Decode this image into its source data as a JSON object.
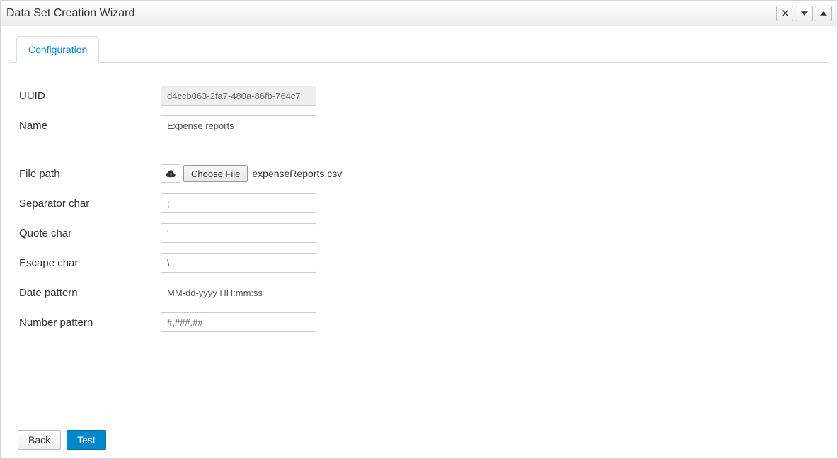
{
  "window": {
    "title": "Data Set Creation Wizard"
  },
  "tabs": {
    "active": "Configuration"
  },
  "form": {
    "uuid_label": "UUID",
    "uuid_value": "d4ccb063-2fa7-480a-86fb-764c7",
    "name_label": "Name",
    "name_value": "Expense reports",
    "file_path_label": "File path",
    "choose_file_label": "Choose File",
    "file_name": "expenseReports.csv",
    "separator_label": "Separator char",
    "separator_value": ";",
    "quote_label": "Quote char",
    "quote_value": "'",
    "escape_label": "Escape char",
    "escape_value": "\\",
    "date_pattern_label": "Date pattern",
    "date_pattern_value": "MM-dd-yyyy HH:mm:ss",
    "number_pattern_label": "Number pattern",
    "number_pattern_value": "#,###.##"
  },
  "footer": {
    "back_label": "Back",
    "test_label": "Test"
  }
}
